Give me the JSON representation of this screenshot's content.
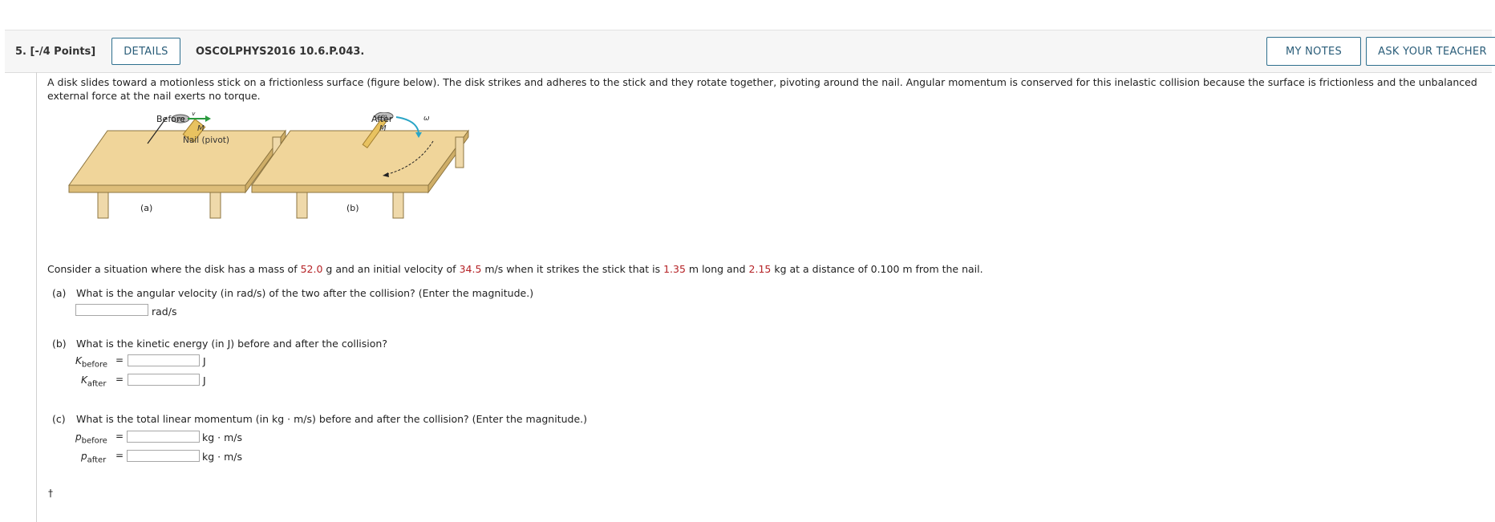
{
  "header": {
    "question_label": "5.  [-/4 Points]",
    "details_label": "DETAILS",
    "code": "OSCOLPHYS2016 10.6.P.043.",
    "my_notes_label": "MY NOTES",
    "ask_label": "ASK YOUR TEACHER"
  },
  "intro": "A disk slides toward a motionless stick on a frictionless surface (figure below). The disk strikes and adheres to the stick and they rotate together, pivoting around the nail. Angular momentum is conserved for this inelastic collision because the surface is frictionless and the unbalanced external force at the nail exerts no torque.",
  "figure": {
    "before_label": "Before",
    "after_label": "After",
    "m_label": "m",
    "v_label": "v",
    "M_label": "M",
    "nail_label": "Nail (pivot)",
    "omega_label": "ω",
    "a_label": "(a)",
    "b_label": "(b)"
  },
  "scenario": {
    "t1": "Consider a situation where the disk has a mass of ",
    "mass": "52.0",
    "t2": " g and an initial velocity of ",
    "velocity": "34.5",
    "t3": " m/s when it strikes the stick that is ",
    "length": "1.35",
    "t4": " m long and ",
    "stick_mass": "2.15",
    "t5": " kg at a distance of 0.100 m from the nail."
  },
  "parts": {
    "a": {
      "letter": "(a)",
      "question": "What is the angular velocity (in rad/s) of the two after the collision? (Enter the magnitude.)",
      "unit": "rad/s",
      "value": ""
    },
    "b": {
      "letter": "(b)",
      "question": "What is the kinetic energy (in J) before and after the collision?",
      "before_var": "K",
      "before_sub": "before",
      "after_var": "K",
      "after_sub": "after",
      "eq": "=",
      "unit": "J"
    },
    "c": {
      "letter": "(c)",
      "question": "What is the total linear momentum (in kg · m/s) before and after the collision? (Enter the magnitude.)",
      "before_var": "p",
      "before_sub": "before",
      "after_var": "p",
      "after_sub": "after",
      "eq": "=",
      "unit": "kg · m/s"
    }
  },
  "footer": {
    "dagger": "†"
  },
  "colors": {
    "accent": "#2a5d79",
    "highlight": "#b52226",
    "table": "#f0d59a"
  }
}
